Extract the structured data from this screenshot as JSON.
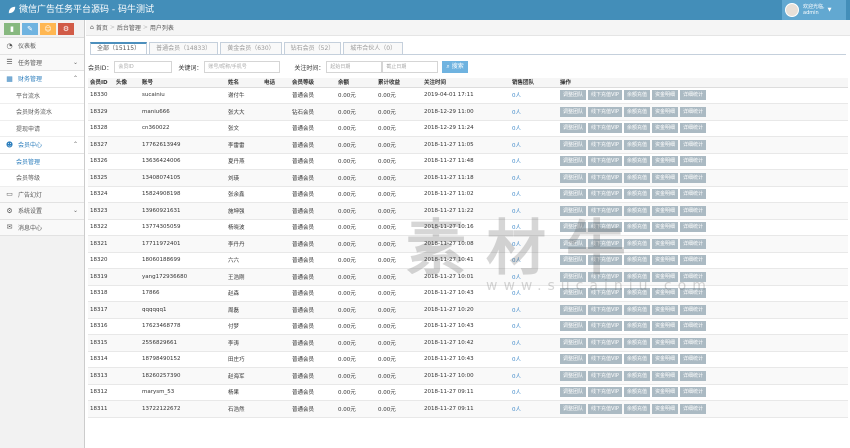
{
  "header": {
    "title": "微信广告任务平台源码 - 码牛测试",
    "welcome": "欢迎光临,",
    "username": "admin",
    "colors": {
      "bar": "#438eb9",
      "userbox": "#62a8d1"
    }
  },
  "shortcuts": [
    {
      "icon": "chart-icon",
      "glyph": "▮",
      "color": "#87b87f"
    },
    {
      "icon": "pencil-icon",
      "glyph": "✎",
      "color": "#6fb3e0"
    },
    {
      "icon": "users-icon",
      "glyph": "☺",
      "color": "#ffb752"
    },
    {
      "icon": "cogs-icon",
      "glyph": "⚙",
      "color": "#d15b47"
    }
  ],
  "sidebar": {
    "items": [
      {
        "label": "仪表板",
        "icon": "dashboard-icon",
        "glyph": "◔"
      },
      {
        "label": "任务管理",
        "icon": "task-icon",
        "glyph": "☰"
      },
      {
        "label": "财务管理",
        "icon": "finance-icon",
        "glyph": "▦"
      },
      {
        "label": "平台流水"
      },
      {
        "label": "会员财务流水"
      },
      {
        "label": "提现申请"
      },
      {
        "label": "会员中心",
        "icon": "member-icon",
        "glyph": "☻"
      },
      {
        "label": "会员管理"
      },
      {
        "label": "会员等级"
      },
      {
        "label": "广告幻灯",
        "icon": "slide-icon",
        "glyph": "▭"
      },
      {
        "label": "系统设置",
        "icon": "settings-icon",
        "glyph": "⚙"
      },
      {
        "label": "消息中心",
        "icon": "message-icon",
        "glyph": "✉"
      }
    ]
  },
  "breadcrumb": [
    "首页",
    "后台管理",
    "用户列表"
  ],
  "tabs": [
    "全部（15115）",
    "普通会员（14833）",
    "黄金会员（630）",
    "钻石会员（52）",
    "城市合伙人（0）"
  ],
  "filter": {
    "id_label": "会员ID：",
    "id_placeholder": "会员ID",
    "keyword_label": "关键词：",
    "keyword_placeholder": "账号/昵称/手机号",
    "time_label": "关注时间：",
    "start_placeholder": "起始日期",
    "end_placeholder": "截止日期",
    "search_button": "搜索"
  },
  "table": {
    "columns": [
      "会员ID",
      "头像",
      "账号",
      "姓名",
      "电话",
      "会员等级",
      "余额",
      "累计收益",
      "关注时间",
      "销售团队",
      "操作"
    ],
    "actions": [
      "调整团队",
      "线下充值VIP",
      "余额充值",
      "资金明细",
      "详细统计"
    ],
    "rows": [
      [
        "18330",
        "",
        "sucainiu",
        "谢付牛",
        "",
        "普通会员",
        "0.00元",
        "0.00元",
        "2019-04-01 17:11",
        "0人"
      ],
      [
        "18329",
        "",
        "maniu666",
        "张大大",
        "",
        "钻石会员",
        "0.00元",
        "0.00元",
        "2018-12-29 11:00",
        "0人"
      ],
      [
        "18328",
        "",
        "cn360022",
        "张文",
        "",
        "普通会员",
        "0.00元",
        "0.00元",
        "2018-12-29 11:24",
        "0人"
      ],
      [
        "18327",
        "",
        "17762613949",
        "李雷雷",
        "",
        "普通会员",
        "0.00元",
        "0.00元",
        "2018-11-27 11:05",
        "0人"
      ],
      [
        "18326",
        "",
        "13636424006",
        "夏丹燕",
        "",
        "普通会员",
        "0.00元",
        "0.00元",
        "2018-11-27 11:48",
        "0人"
      ],
      [
        "18325",
        "",
        "13408074105",
        "刘瑛",
        "",
        "普通会员",
        "0.00元",
        "0.00元",
        "2018-11-27 11:18",
        "0人"
      ],
      [
        "18324",
        "",
        "15824908198",
        "张余鑫",
        "",
        "普通会员",
        "0.00元",
        "0.00元",
        "2018-11-27 11:02",
        "0人"
      ],
      [
        "18323",
        "",
        "13960921631",
        "施坤强",
        "",
        "普通会员",
        "0.00元",
        "0.00元",
        "2018-11-27 11:22",
        "0人"
      ],
      [
        "18322",
        "",
        "13774305059",
        "杨晓波",
        "",
        "普通会员",
        "0.00元",
        "0.00元",
        "2018-11-27 10:16",
        "0人"
      ],
      [
        "18321",
        "",
        "17711972401",
        "李丹丹",
        "",
        "普通会员",
        "0.00元",
        "0.00元",
        "2018-11-27 10:08",
        "0人"
      ],
      [
        "18320",
        "",
        "18060188699",
        "六六",
        "",
        "普通会员",
        "0.00元",
        "0.00元",
        "2018-11-27 10:41",
        "0人"
      ],
      [
        "18319",
        "",
        "yang172936680",
        "王浩刚",
        "",
        "普通会员",
        "0.00元",
        "0.00元",
        "2018-11-27 10:01",
        "0人"
      ],
      [
        "18318",
        "",
        "17866",
        "赵森",
        "",
        "普通会员",
        "0.00元",
        "0.00元",
        "2018-11-27 10:43",
        "0人"
      ],
      [
        "18317",
        "",
        "qqqqqq1",
        "周磊",
        "",
        "普通会员",
        "0.00元",
        "0.00元",
        "2018-11-27 10:20",
        "0人"
      ],
      [
        "18316",
        "",
        "17623468778",
        "付梦",
        "",
        "普通会员",
        "0.00元",
        "0.00元",
        "2018-11-27 10:43",
        "0人"
      ],
      [
        "18315",
        "",
        "2556829661",
        "李涛",
        "",
        "普通会员",
        "0.00元",
        "0.00元",
        "2018-11-27 10:42",
        "0人"
      ],
      [
        "18314",
        "",
        "18798490152",
        "田庄巧",
        "",
        "普通会员",
        "0.00元",
        "0.00元",
        "2018-11-27 10:43",
        "0人"
      ],
      [
        "18313",
        "",
        "18260257390",
        "赵海军",
        "",
        "普通会员",
        "0.00元",
        "0.00元",
        "2018-11-27 10:00",
        "0人"
      ],
      [
        "18312",
        "",
        "marysm_53",
        "杨果",
        "",
        "普通会员",
        "0.00元",
        "0.00元",
        "2018-11-27 09:11",
        "0人"
      ],
      [
        "18311",
        "",
        "13722122672",
        "石浩然",
        "",
        "普通会员",
        "0.00元",
        "0.00元",
        "2018-11-27 09:11",
        "0人"
      ]
    ]
  },
  "watermark": {
    "main": "素材牛",
    "sub": "www.sucainiu.com"
  }
}
